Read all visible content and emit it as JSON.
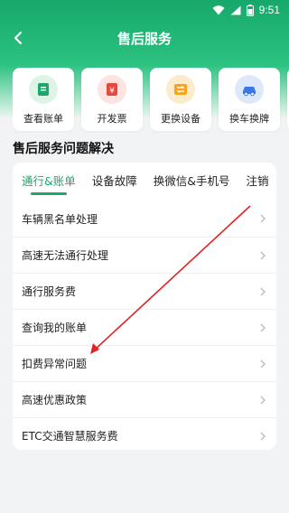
{
  "status": {
    "time": "9:51"
  },
  "nav": {
    "title": "售后服务"
  },
  "quick_actions": [
    {
      "label": "查看账单",
      "icon": "bill-icon",
      "bg": "#dff3e7",
      "fg": "#1aa86b"
    },
    {
      "label": "开发票",
      "icon": "invoice-icon",
      "bg": "#fde3e2",
      "fg": "#e64a3c"
    },
    {
      "label": "更换设备",
      "icon": "device-swap-icon",
      "bg": "#fdeccb",
      "fg": "#f3a51b"
    },
    {
      "label": "换车换牌",
      "icon": "car-icon",
      "bg": "#dde9fb",
      "fg": "#3a78e6"
    }
  ],
  "section": {
    "title": "售后服务问题解决"
  },
  "tabs": [
    {
      "label": "通行&账单",
      "active": true
    },
    {
      "label": "设备故障"
    },
    {
      "label": "换微信&手机号"
    },
    {
      "label": "注销"
    }
  ],
  "items": [
    {
      "label": "车辆黑名单处理"
    },
    {
      "label": "高速无法通行处理"
    },
    {
      "label": "通行服务费"
    },
    {
      "label": "查询我的账单"
    },
    {
      "label": "扣费异常问题"
    },
    {
      "label": "高速优惠政策"
    },
    {
      "label": "ETC交通智慧服务费"
    }
  ],
  "colors": {
    "brand": "#1aa86b",
    "annotation_arrow": "#e02525"
  }
}
